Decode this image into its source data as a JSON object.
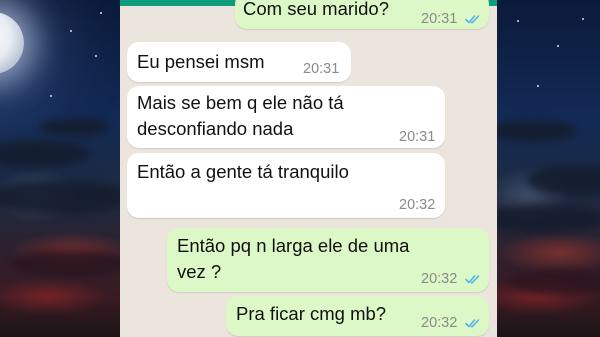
{
  "chat": {
    "messages": [
      {
        "direction": "outgoing",
        "text": "Com seu marido?",
        "time": "20:31",
        "status": "read"
      },
      {
        "direction": "incoming",
        "text": "Eu pensei msm",
        "time": "20:31"
      },
      {
        "direction": "incoming",
        "text": "Mais se bem q ele não tá\ndesconfiando nada",
        "time": "20:31"
      },
      {
        "direction": "incoming",
        "text": "Então a gente tá tranquilo",
        "time": "20:32"
      },
      {
        "direction": "outgoing",
        "text": "Então pq n larga ele de uma\nvez ?",
        "time": "20:32",
        "status": "read"
      },
      {
        "direction": "outgoing",
        "text": "Pra ficar cmg mb?",
        "time": "20:32",
        "status": "read"
      }
    ]
  },
  "colors": {
    "incoming_bubble": "#ffffff",
    "outgoing_bubble": "#dcf8c6",
    "chat_background": "#ece5dd",
    "read_ticks": "#4fb6ec",
    "header_bar": "#0e9e7e"
  },
  "icons": {
    "read_receipt": "double-check-icon"
  }
}
